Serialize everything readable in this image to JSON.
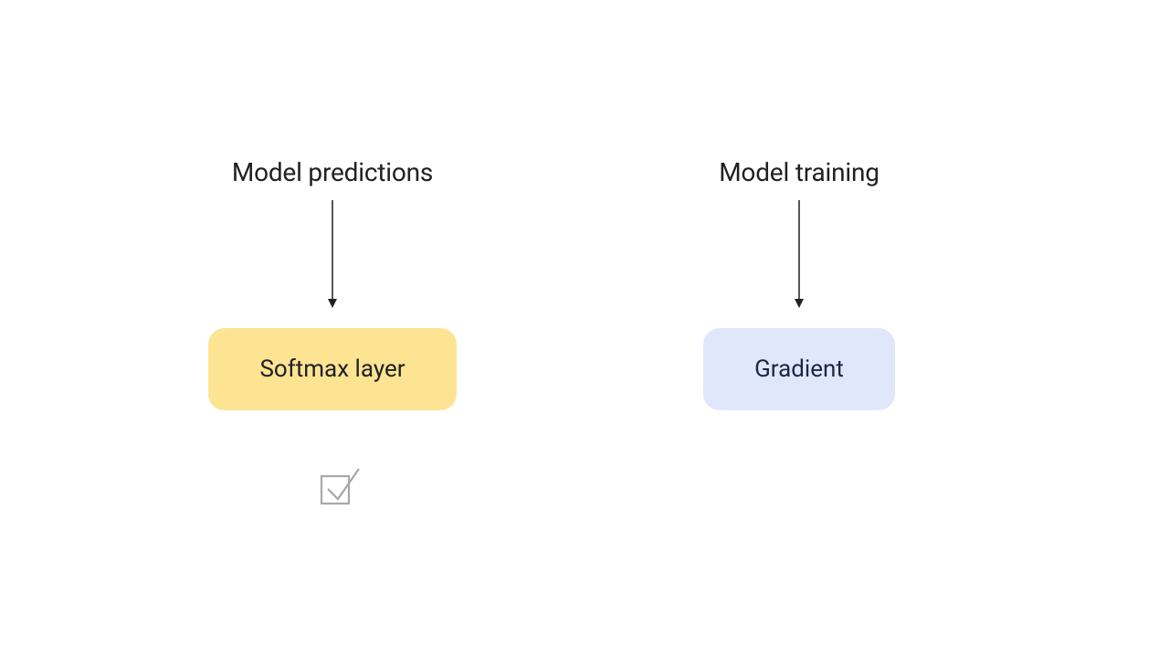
{
  "diagram": {
    "left": {
      "heading": "Model predictions",
      "node_label": "Softmax layer"
    },
    "right": {
      "heading": "Model training",
      "node_label": "Gradient"
    },
    "colors": {
      "yellow_bg": "#fde493",
      "blue_bg": "#e1e7fb",
      "text_dark": "#202124",
      "text_navy": "#1a2744",
      "check_stroke": "#a8a8a8"
    }
  }
}
